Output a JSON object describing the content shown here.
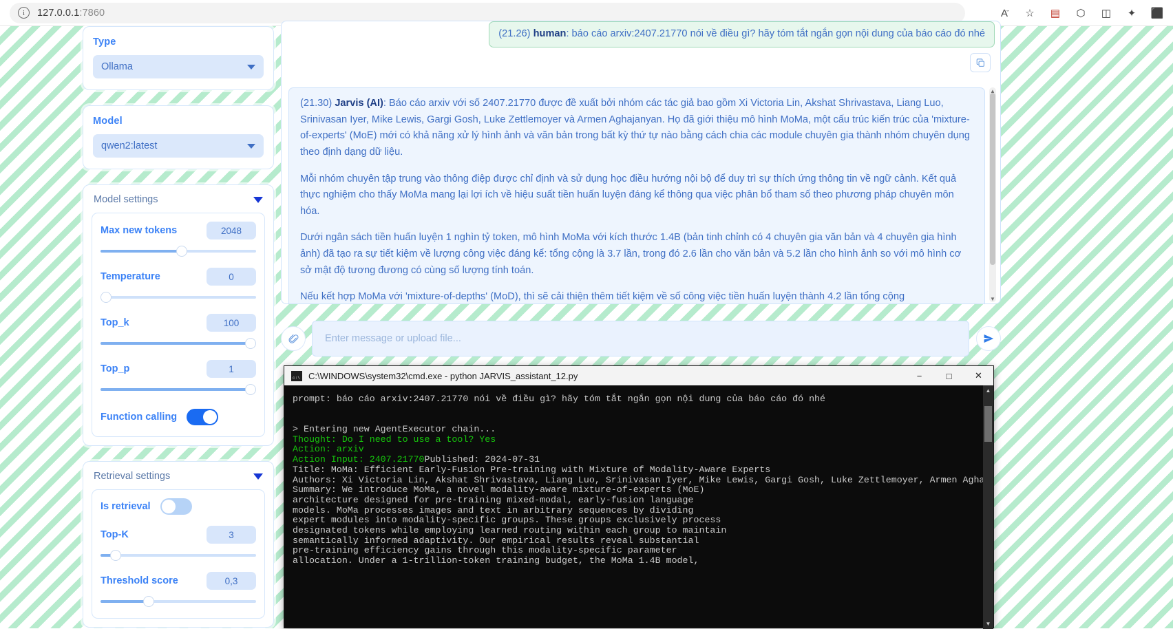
{
  "browser": {
    "url_host": "127.0.0.1",
    "url_port": ":7860",
    "info_icon": "info-icon",
    "icons": [
      "read-aloud-icon",
      "favorite-icon",
      "collections-icon",
      "extensions-icon",
      "split-screen-icon",
      "favorites-bar-icon",
      "settings-icon"
    ]
  },
  "sidebar": {
    "type": {
      "label": "Type",
      "value": "Ollama"
    },
    "model": {
      "label": "Model",
      "value": "qwen2:latest"
    },
    "model_settings": {
      "title": "Model settings",
      "fields": [
        {
          "label": "Max new tokens",
          "value": "2048",
          "percent": 52
        },
        {
          "label": "Temperature",
          "value": "0",
          "percent": 0
        },
        {
          "label": "Top_k",
          "value": "100",
          "percent": 100
        },
        {
          "label": "Top_p",
          "value": "1",
          "percent": 100
        }
      ],
      "toggle": {
        "label": "Function calling",
        "state": "on"
      }
    },
    "retrieval_settings": {
      "title": "Retrieval settings",
      "toggle": {
        "label": "Is retrieval",
        "state": "off"
      },
      "fields": [
        {
          "label": "Top-K",
          "value": "3",
          "percent": 7
        },
        {
          "label": "Threshold score",
          "value": "0,3",
          "percent": 30
        }
      ]
    }
  },
  "chat": {
    "human": {
      "time": "(21.26)",
      "role": "human",
      "text": ": báo cáo arxiv:2407.21770 nói về điều gì? hãy tóm tắt ngắn gọn nội dung của báo cáo đó nhé"
    },
    "copy_icon": "copy-icon",
    "ai": {
      "time": "(21.30)",
      "role": "Jarvis (AI)",
      "paragraphs": [
        ": Báo cáo arxiv với số 2407.21770 được đề xuất bởi nhóm các tác giả bao gồm Xi Victoria Lin, Akshat Shrivastava, Liang Luo, Srinivasan Iyer, Mike Lewis, Gargi Gosh, Luke Zettlemoyer và Armen Aghajanyan. Họ đã giới thiệu mô hình MoMa, một cấu trúc kiến trúc của 'mixture-of-experts' (MoE) mới có khả năng xử lý hình ảnh và văn bản trong bất kỳ thứ tự nào bằng cách chia các module chuyên gia thành nhóm chuyên dụng theo định dạng dữ liệu.",
        "Mỗi nhóm chuyên tập trung vào thông điệp được chỉ định và sử dụng học điều hướng nội bộ để duy trì sự thích ứng thông tin về ngữ cảnh. Kết quả thực nghiệm cho thấy MoMa mang lại lợi ích về hiệu suất tiền huấn luyện đáng kể thông qua việc phân bổ tham số theo phương pháp chuyên môn hóa.",
        "Dưới ngân sách tiền huấn luyện 1 nghìn tỷ token, mô hình MoMa với kích thước 1.4B (bản tinh chỉnh có 4 chuyên gia văn bản và 4 chuyên gia hình ảnh) đã tạo ra sự tiết kiệm về lượng công việc đáng kể: tổng cộng là 3.7 lần, trong đó 2.6 lần cho văn bản và 5.2 lần cho hình ảnh so với mô hình cơ sở mật độ tương đương có cùng số lượng tính toán.",
        "Nếu kết hợp MoMa với 'mixture-of-depths' (MoD), thì sẽ cải thiện thêm tiết kiệm về số công việc tiền huấn luyện thành 4.2 lần tổng cộng"
      ]
    }
  },
  "composer": {
    "attach_icon": "paperclip-icon",
    "placeholder": "Enter message or upload file...",
    "send_icon": "send-icon"
  },
  "terminal": {
    "icon": "cmd-icon",
    "title": "C:\\WINDOWS\\system32\\cmd.exe - python  JARVIS_assistant_12.py",
    "minimize": "−",
    "maximize": "□",
    "close": "✕",
    "lines": [
      {
        "text": "prompt: báo cáo arxiv:2407.21770 nói về điều gì? hãy tóm tắt ngắn gọn nội dung của báo cáo đó nhé",
        "color": "w"
      },
      {
        "text": "",
        "color": "w"
      },
      {
        "text": "",
        "color": "w"
      },
      {
        "text": "> Entering new AgentExecutor chain...",
        "color": "w"
      },
      {
        "text": "Thought: Do I need to use a tool? Yes",
        "color": "g"
      },
      {
        "text": "Action: arxiv",
        "color": "g"
      },
      {
        "text": "Action Input: 2407.21770",
        "color": "g",
        "tail": "Published: 2024-07-31",
        "tail_color": "w"
      },
      {
        "text": "Title: MoMa: Efficient Early-Fusion Pre-training with Mixture of Modality-Aware Experts",
        "color": "w"
      },
      {
        "text": "Authors: Xi Victoria Lin, Akshat Shrivastava, Liang Luo, Srinivasan Iyer, Mike Lewis, Gargi Gosh, Luke Zettlemoyer, Armen Aghajanyan",
        "color": "w"
      },
      {
        "text": "Summary: We introduce MoMa, a novel modality-aware mixture-of-experts (MoE)",
        "color": "w"
      },
      {
        "text": "architecture designed for pre-training mixed-modal, early-fusion language",
        "color": "w"
      },
      {
        "text": "models. MoMa processes images and text in arbitrary sequences by dividing",
        "color": "w"
      },
      {
        "text": "expert modules into modality-specific groups. These groups exclusively process",
        "color": "w"
      },
      {
        "text": "designated tokens while employing learned routing within each group to maintain",
        "color": "w"
      },
      {
        "text": "semantically informed adaptivity. Our empirical results reveal substantial",
        "color": "w"
      },
      {
        "text": "pre-training efficiency gains through this modality-specific parameter",
        "color": "w"
      },
      {
        "text": "allocation. Under a 1-trillion-token training budget, the MoMa 1.4B model,",
        "color": "w"
      }
    ]
  },
  "colors": {
    "accent_blue": "#3b82f6",
    "toggle_on": "#1a6bf2",
    "stripe_green": "#a9e8c4",
    "terminal_green": "#16c60c",
    "terminal_bg": "#0c0c0c"
  }
}
